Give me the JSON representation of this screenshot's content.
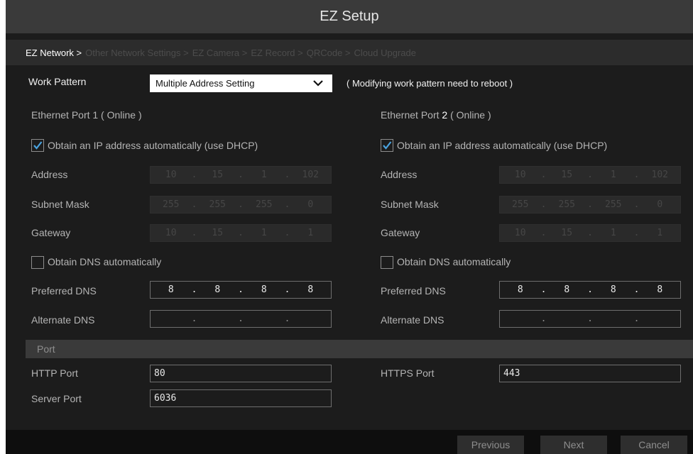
{
  "window": {
    "title": "EZ Setup"
  },
  "breadcrumb": [
    "EZ Network >",
    "Other Network Settings >",
    "EZ Camera >",
    "EZ Record >",
    "QRCode >",
    "Cloud Upgrade"
  ],
  "work_pattern": {
    "label": "Work Pattern",
    "value": "Multiple Address Setting",
    "note": "( Modifying work pattern need to reboot )",
    "icon": "chevron-down-icon"
  },
  "port1": {
    "title": "Ethernet Port 1 ( Online )",
    "dhcp_label": "Obtain an IP address automatically (use DHCP)",
    "dhcp_checked": true,
    "address_label": "Address",
    "address": [
      "10",
      "15",
      "1",
      "102"
    ],
    "subnet_label": "Subnet Mask",
    "subnet": [
      "255",
      "255",
      "255",
      "0"
    ],
    "gateway_label": "Gateway",
    "gateway": [
      "10",
      "15",
      "1",
      "1"
    ],
    "dns_auto_label": "Obtain DNS automatically",
    "dns_auto_checked": false,
    "preferred_dns_label": "Preferred DNS",
    "preferred_dns": [
      "8",
      "8",
      "8",
      "8"
    ],
    "alternate_dns_label": "Alternate DNS",
    "alternate_dns": [
      "",
      "",
      "",
      ""
    ]
  },
  "port2": {
    "title_prefix": "Ethernet Port ",
    "title_num": "2",
    "title_suffix": " ( Online )",
    "dhcp_label": "Obtain an IP address automatically (use DHCP)",
    "dhcp_checked": true,
    "address_label": "Address",
    "address": [
      "10",
      "15",
      "1",
      "102"
    ],
    "subnet_label": "Subnet Mask",
    "subnet": [
      "255",
      "255",
      "255",
      "0"
    ],
    "gateway_label": "Gateway",
    "gateway": [
      "10",
      "15",
      "1",
      "1"
    ],
    "dns_auto_label": "Obtain DNS automatically",
    "dns_auto_checked": false,
    "preferred_dns_label": "Preferred DNS",
    "preferred_dns": [
      "8",
      "8",
      "8",
      "8"
    ],
    "alternate_dns_label": "Alternate DNS",
    "alternate_dns": [
      "",
      "",
      "",
      ""
    ]
  },
  "ports": {
    "section_label": "Port",
    "http_label": "HTTP Port",
    "http_value": "80",
    "https_label": "HTTPS Port",
    "https_value": "443",
    "server_label": "Server Port",
    "server_value": "6036"
  },
  "buttons": {
    "previous": "Previous",
    "next": "Next",
    "cancel": "Cancel"
  },
  "colors": {
    "background": "#1c1c1c",
    "titlebar": "#3a3a3a",
    "check_accent": "#4aa3df"
  }
}
